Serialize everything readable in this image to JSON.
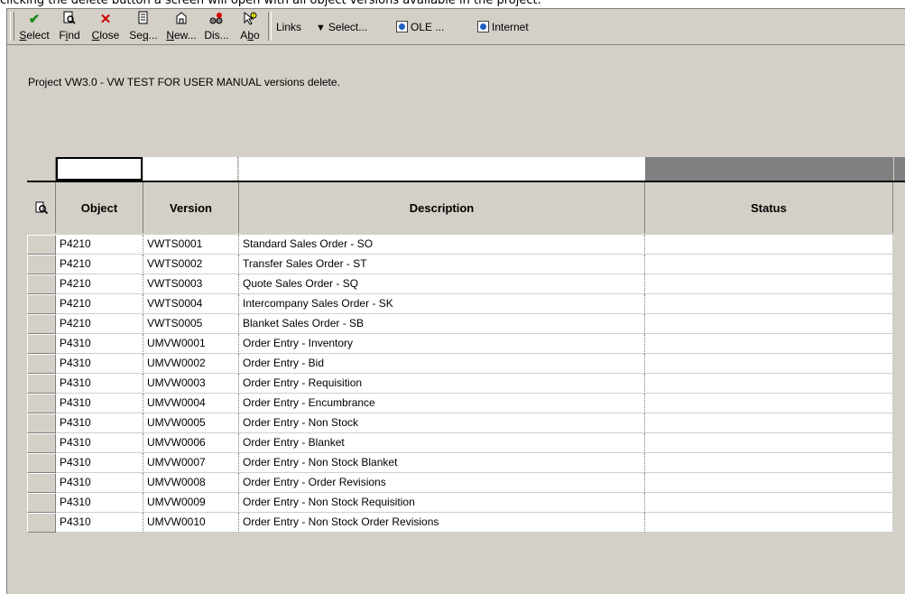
{
  "caption": "clicking the delete button a screen will open with all object versions available in the project.",
  "toolbar": {
    "buttons": [
      {
        "label": "Select",
        "mnemonic": "S",
        "rest": "elect",
        "icon": "checkmark-icon"
      },
      {
        "label": "Find",
        "mnemonic": "i",
        "pre": "F",
        "rest": "nd",
        "icon": "find-icon"
      },
      {
        "label": "Close",
        "mnemonic": "C",
        "rest": "lose",
        "icon": "close-icon"
      },
      {
        "label": "Seq...",
        "pre": "Se",
        "mnemonic": "q",
        "rest": "...",
        "icon": "sequence-icon"
      },
      {
        "label": "New...",
        "mnemonic": "N",
        "rest": "ew...",
        "icon": "new-icon"
      },
      {
        "label": "Dis...",
        "pre": "Dis...",
        "mnemonic": "",
        "rest": "",
        "icon": "display-icon"
      },
      {
        "label": "Abo",
        "pre": "A",
        "mnemonic": "b",
        "rest": "o",
        "icon": "about-icon"
      }
    ],
    "links_label": "Links",
    "select_label": "Select...",
    "ole_label": "OLE ...",
    "internet_label": "Internet"
  },
  "project_line": "Project VW3.0 - VW TEST FOR USER MANUAL versions delete.",
  "table": {
    "columns": [
      "Object",
      "Version",
      "Description",
      "Status"
    ],
    "rows": [
      {
        "object": "P4210",
        "version": "VWTS0001",
        "description": "Standard Sales Order - SO",
        "status": ""
      },
      {
        "object": "P4210",
        "version": "VWTS0002",
        "description": "Transfer Sales Order - ST",
        "status": ""
      },
      {
        "object": "P4210",
        "version": "VWTS0003",
        "description": "Quote Sales Order - SQ",
        "status": ""
      },
      {
        "object": "P4210",
        "version": "VWTS0004",
        "description": "Intercompany Sales Order - SK",
        "status": ""
      },
      {
        "object": "P4210",
        "version": "VWTS0005",
        "description": "Blanket Sales Order - SB",
        "status": ""
      },
      {
        "object": "P4310",
        "version": "UMVW0001",
        "description": "Order Entry - Inventory",
        "status": ""
      },
      {
        "object": "P4310",
        "version": "UMVW0002",
        "description": "Order Entry - Bid",
        "status": ""
      },
      {
        "object": "P4310",
        "version": "UMVW0003",
        "description": "Order Entry - Requisition",
        "status": ""
      },
      {
        "object": "P4310",
        "version": "UMVW0004",
        "description": "Order Entry - Encumbrance",
        "status": ""
      },
      {
        "object": "P4310",
        "version": "UMVW0005",
        "description": "Order Entry - Non Stock",
        "status": ""
      },
      {
        "object": "P4310",
        "version": "UMVW0006",
        "description": "Order Entry - Blanket",
        "status": ""
      },
      {
        "object": "P4310",
        "version": "UMVW0007",
        "description": "Order Entry - Non Stock Blanket",
        "status": ""
      },
      {
        "object": "P4310",
        "version": "UMVW0008",
        "description": "Order Entry - Order Revisions",
        "status": ""
      },
      {
        "object": "P4310",
        "version": "UMVW0009",
        "description": "Order Entry - Non Stock Requisition",
        "status": ""
      },
      {
        "object": "P4310",
        "version": "UMVW0010",
        "description": "Order Entry - Non Stock Order Revisions",
        "status": ""
      }
    ]
  },
  "colors": {
    "face": "#d4d0c8",
    "shadow": "#808080",
    "check": "#1a8a1a",
    "close": "#cc0000"
  }
}
